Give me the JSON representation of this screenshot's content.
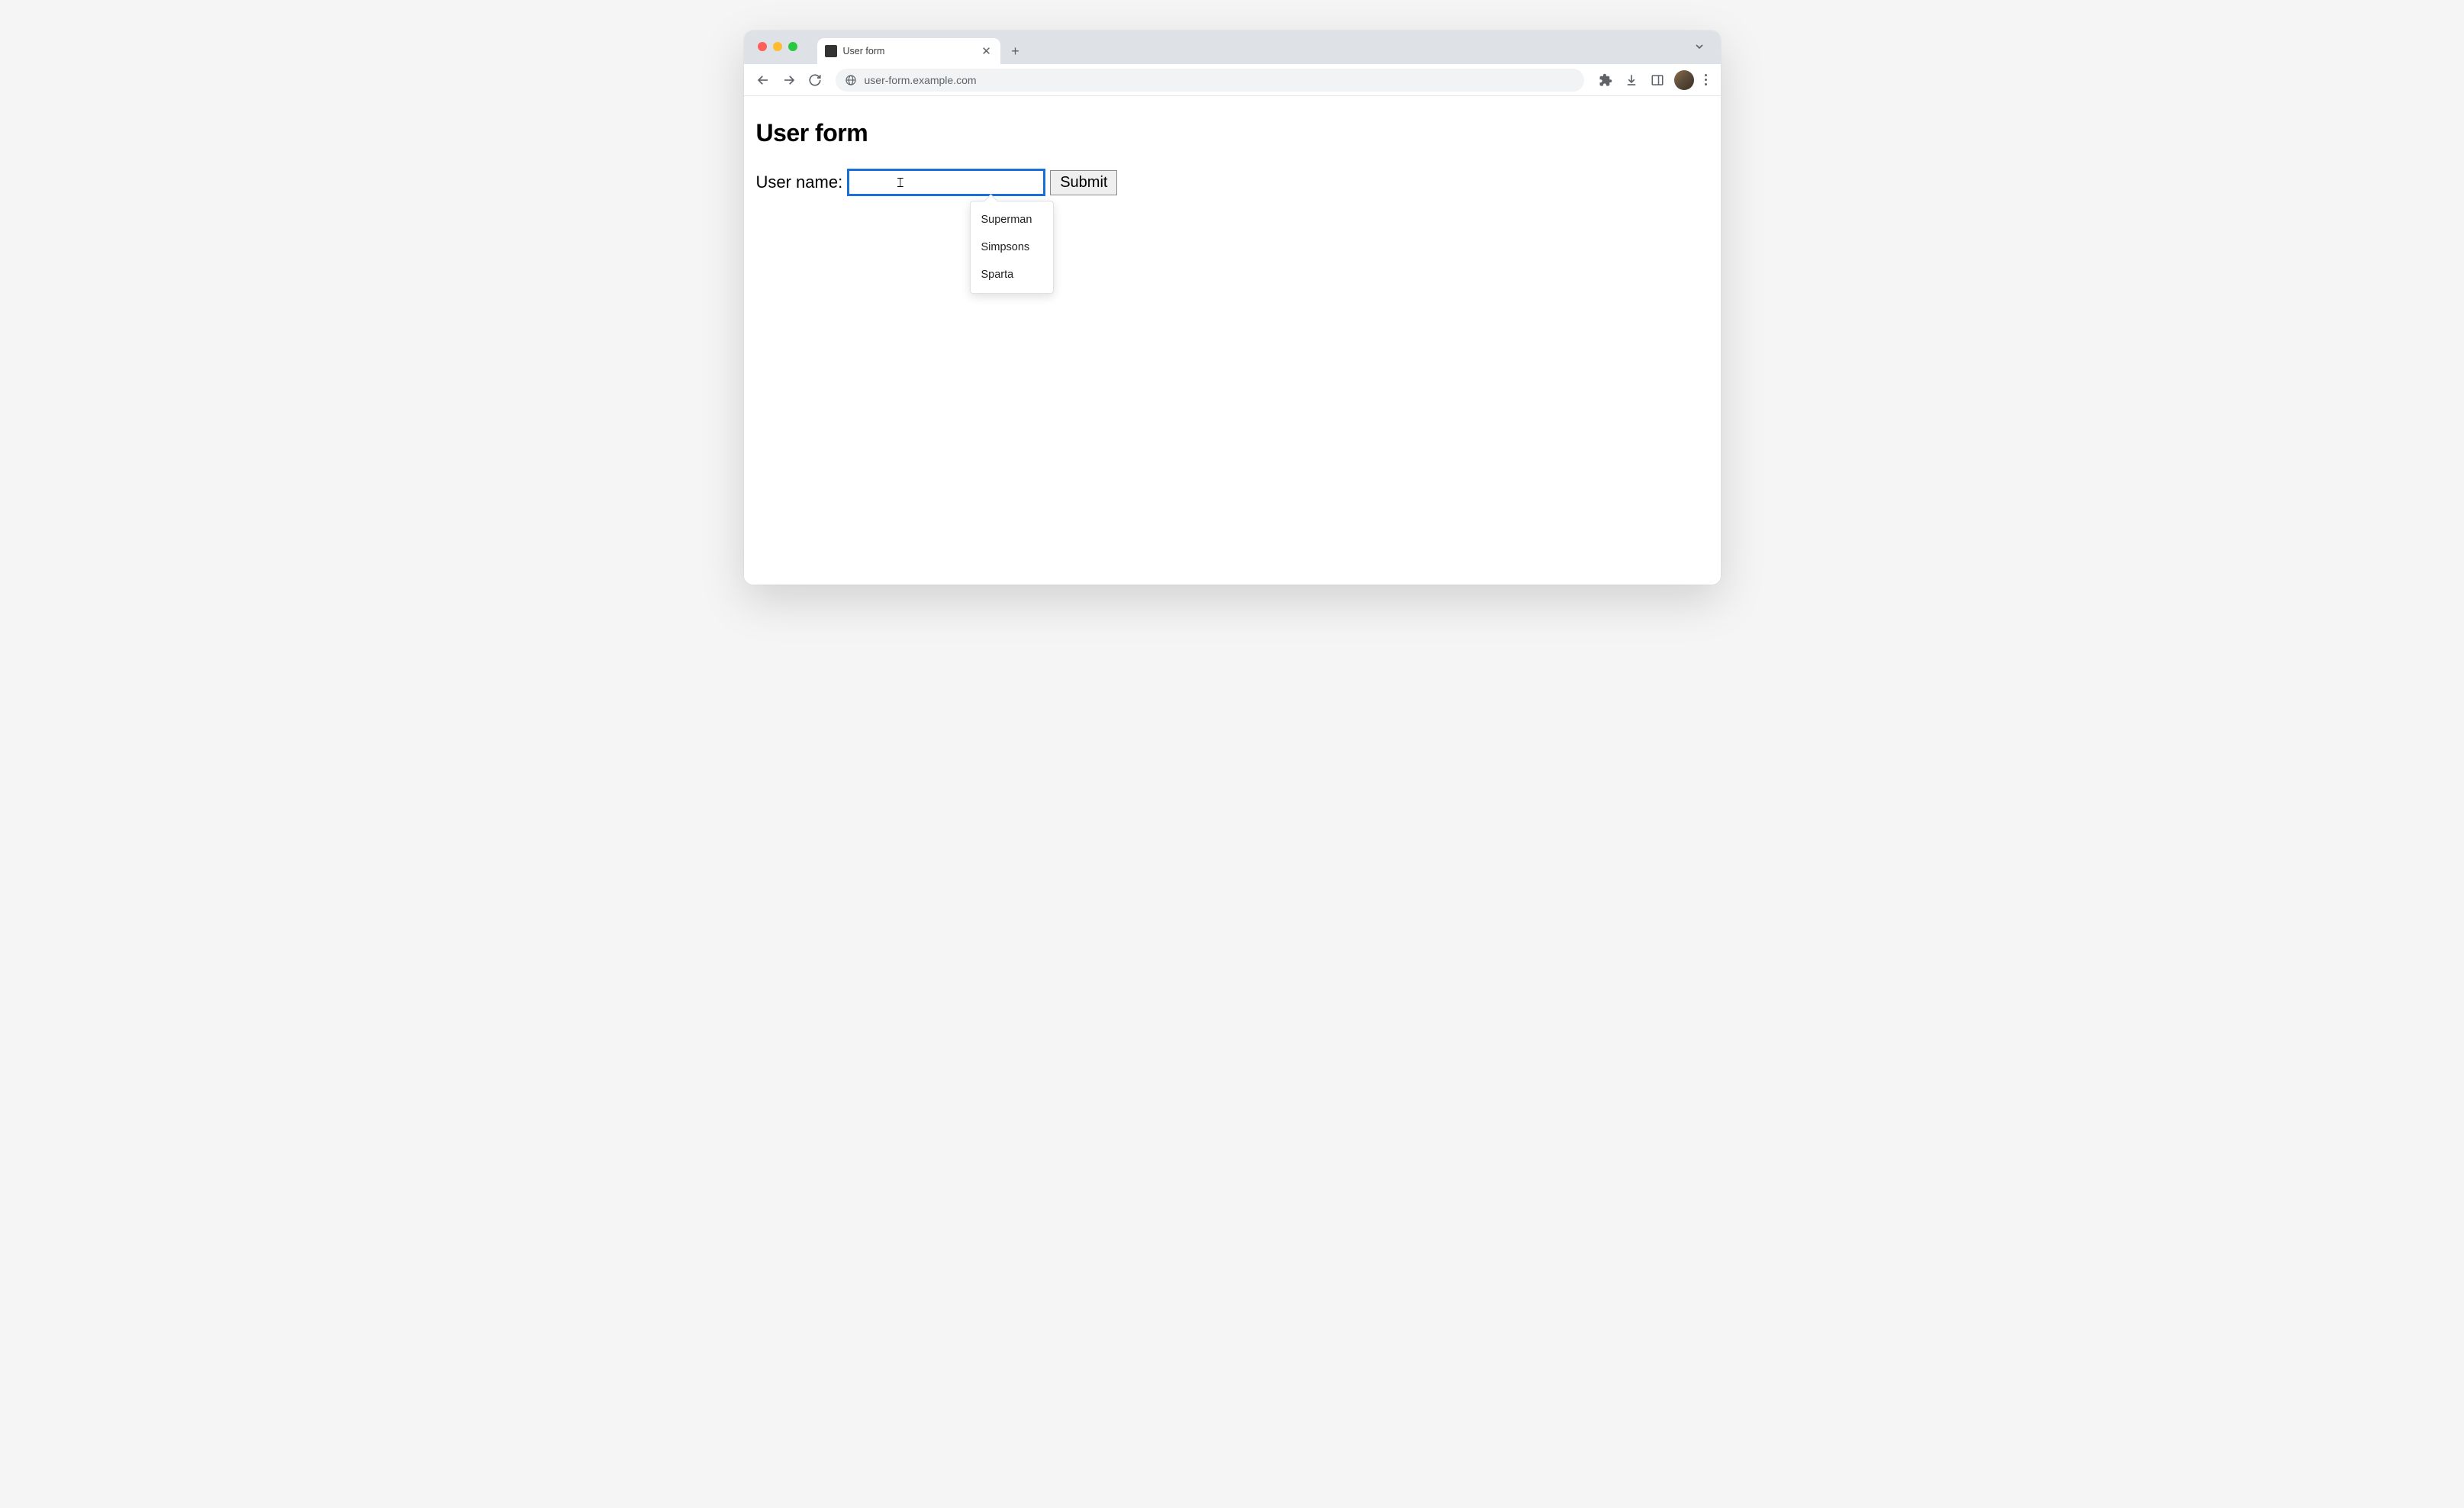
{
  "browser": {
    "tab_title": "User form",
    "url": "user-form.example.com"
  },
  "page": {
    "heading": "User form",
    "form": {
      "label": "User name:",
      "input_value": "",
      "submit_label": "Submit"
    },
    "autocomplete": {
      "items": [
        "Superman",
        "Simpsons",
        "Sparta"
      ]
    }
  }
}
